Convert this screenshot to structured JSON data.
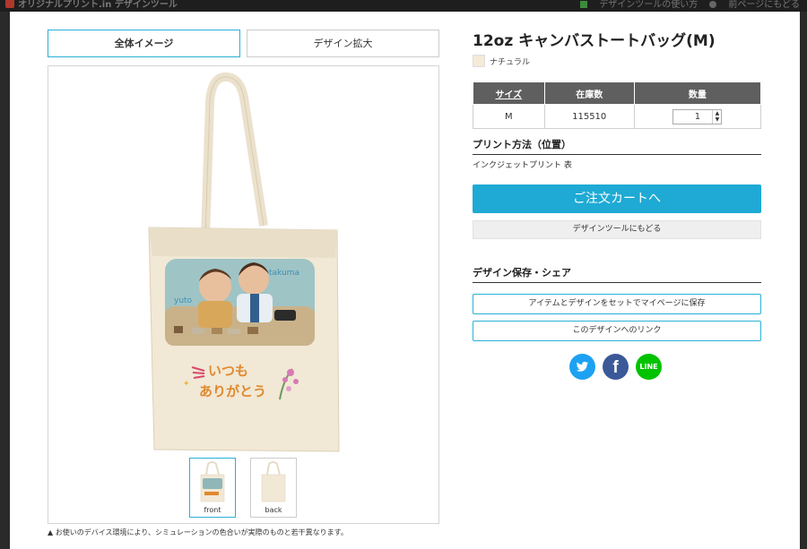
{
  "topbar": {
    "brand": "オリジナルプリント.in  デザインツール",
    "link_howto": "デザインツールの使い方",
    "link_back": "前ページにもどる"
  },
  "tabs": {
    "overall": "全体イメージ",
    "zoom": "デザイン拡大"
  },
  "preview": {
    "name_left": "yuto",
    "name_right": "takuma",
    "message_line1": "いつも",
    "message_line2": "ありがとう"
  },
  "thumbnails": {
    "front": "front",
    "back": "back"
  },
  "notice": "お使いのデバイス環境により、シミュレーションの色合いが実際のものと若干異なります。",
  "product": {
    "title": "12oz キャンバストートバッグ(M)",
    "color": "ナチュラル",
    "color_hex": "#f4ead8"
  },
  "stock_table": {
    "headers": {
      "size": "サイズ",
      "stock": "在庫数",
      "qty": "数量"
    },
    "row": {
      "size": "M",
      "stock": "115510",
      "qty": "1"
    }
  },
  "print_method": {
    "heading": "プリント方法（位置）",
    "value": "インクジェットプリント 表"
  },
  "buttons": {
    "cart": "ご注文カートへ",
    "back_to_tool": "デザインツールにもどる",
    "save": "アイテムとデザインをセットでマイページに保存",
    "link": "このデザインへのリンク"
  },
  "share": {
    "heading": "デザイン保存・シェア",
    "line": "LINE",
    "facebook": "f"
  },
  "colors": {
    "accent": "#2ab0d6",
    "cart_button": "#1eaad4",
    "table_header": "#5f5f5f"
  }
}
